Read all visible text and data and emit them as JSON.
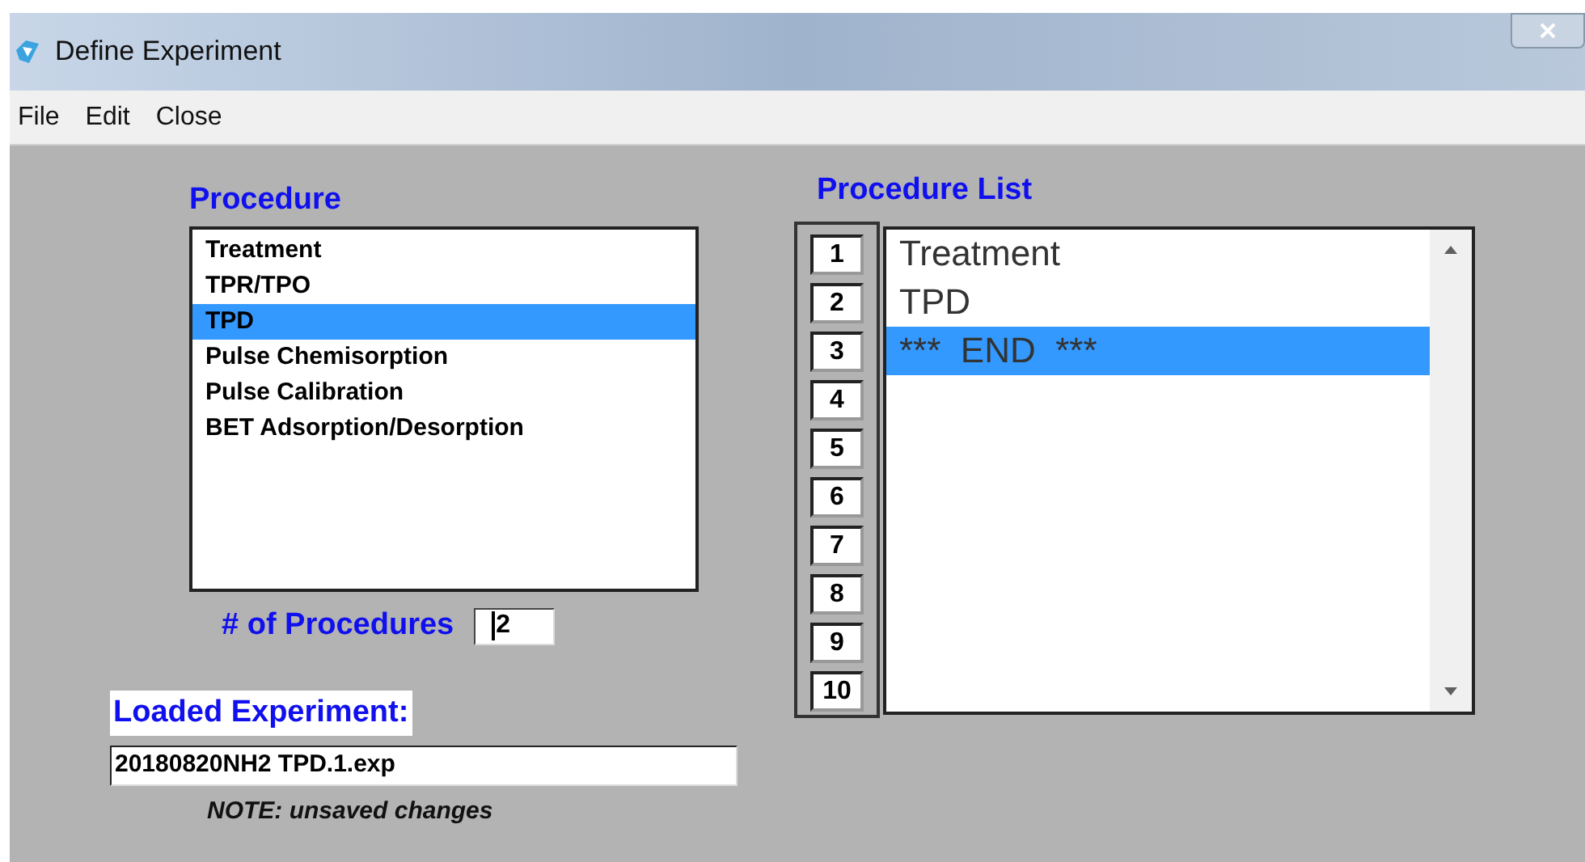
{
  "window": {
    "title": "Define Experiment"
  },
  "menu": [
    "File",
    "Edit",
    "Close"
  ],
  "procedure": {
    "label": "Procedure",
    "items": [
      {
        "label": "Treatment",
        "selected": false
      },
      {
        "label": "TPR/TPO",
        "selected": false
      },
      {
        "label": "TPD",
        "selected": true
      },
      {
        "label": "Pulse Chemisorption",
        "selected": false
      },
      {
        "label": "Pulse Calibration",
        "selected": false
      },
      {
        "label": "BET Adsorption/Desorption",
        "selected": false
      }
    ]
  },
  "procedure_count": {
    "label": "# of Procedures",
    "value": "2"
  },
  "procedure_list": {
    "label": "Procedure List",
    "slots": [
      "1",
      "2",
      "3",
      "4",
      "5",
      "6",
      "7",
      "8",
      "9",
      "10"
    ],
    "items": [
      {
        "label": "Treatment",
        "selected": false
      },
      {
        "label": "TPD",
        "selected": false
      },
      {
        "label": "***  END  ***",
        "selected": true
      }
    ]
  },
  "loaded": {
    "label": "Loaded Experiment:",
    "value": "20180820NH2 TPD.1.exp",
    "note": "NOTE: unsaved changes"
  }
}
